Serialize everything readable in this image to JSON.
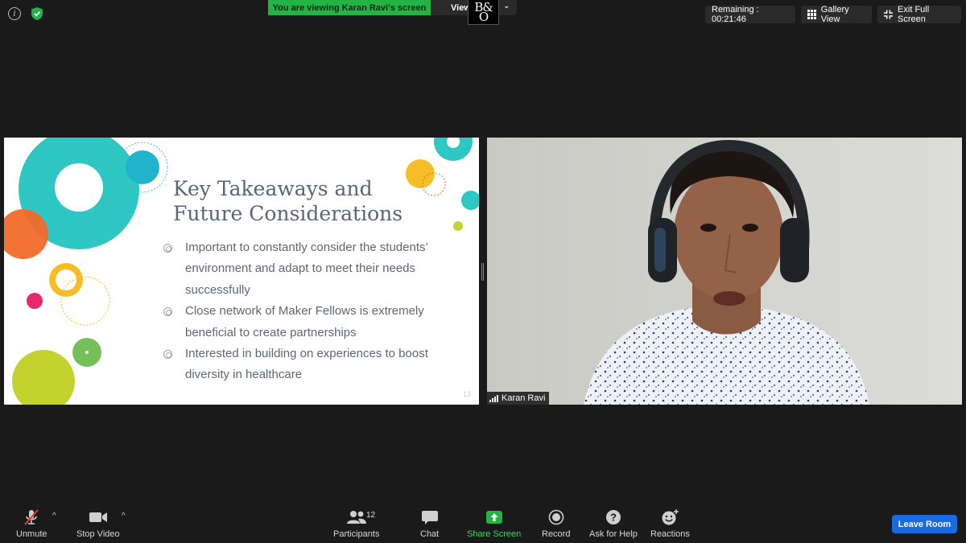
{
  "banner": {
    "viewing_text": "You are viewing Karan Ravi's screen",
    "view_options_label": "View",
    "logo_line1": "B&",
    "logo_line2": "O"
  },
  "top_right": {
    "remaining": "Remaining : 00:21:46",
    "gallery_view": "Gallery View",
    "exit_full_screen": "Exit Full Screen"
  },
  "slide": {
    "title_line1": "Key Takeaways and",
    "title_line2": "Future Considerations",
    "bullets": [
      "Important to constantly consider the students’ environment and adapt to meet their needs successfully",
      "Close network of Maker Fellows is extremely beneficial to create partnerships",
      "Interested in building on experiences to boost diversity in healthcare"
    ],
    "page_number": "13"
  },
  "video": {
    "participant_name": "Karan Ravi"
  },
  "toolbar": {
    "unmute": "Unmute",
    "stop_video": "Stop Video",
    "participants": "Participants",
    "participants_count": "12",
    "chat": "Chat",
    "share_screen": "Share Screen",
    "record": "Record",
    "ask_for_help": "Ask for Help",
    "reactions": "Reactions",
    "leave_room": "Leave Room"
  },
  "colors": {
    "share_green": "#24b445",
    "leave_blue": "#1a6ae0",
    "teal": "#2ec7c4",
    "orange": "#f26a2a",
    "yellow": "#f7bd26",
    "lime": "#c3d22c",
    "pink": "#e8286e",
    "green": "#76c05a"
  }
}
